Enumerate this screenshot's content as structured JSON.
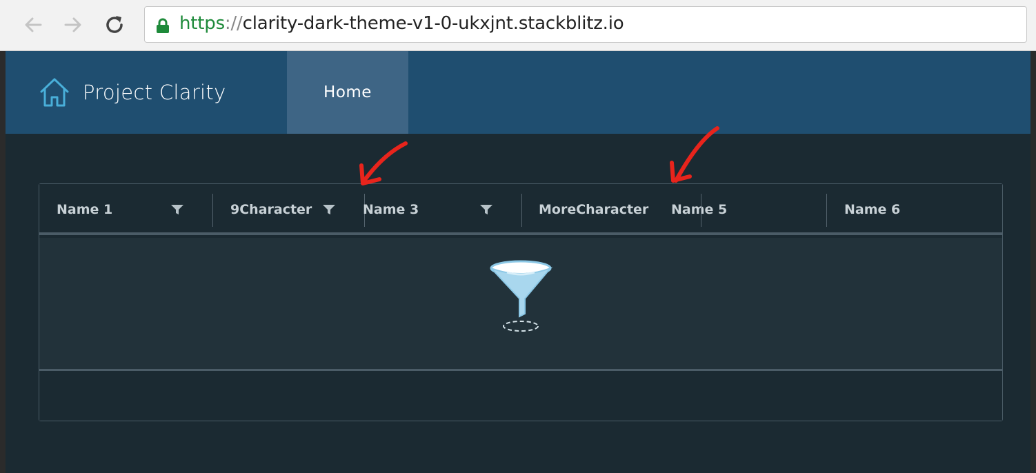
{
  "browser": {
    "url_scheme": "https",
    "url_separator": "://",
    "url_host": "clarity-dark-theme-v1-0-ukxjnt.stackblitz.io",
    "icons": [
      "back-arrow-icon",
      "forward-arrow-icon",
      "reload-icon",
      "lock-icon"
    ]
  },
  "header": {
    "brand_title": "Project Clarity",
    "brand_icon": "home-icon",
    "nav": [
      {
        "label": "Home",
        "active": true
      }
    ]
  },
  "datagrid": {
    "columns": [
      {
        "label": "Name 1",
        "filter": true
      },
      {
        "label": "9Character",
        "filter": true
      },
      {
        "label": "Name 3",
        "filter": true
      },
      {
        "label": "MoreCharacter",
        "filter": false
      },
      {
        "label": "Name 5",
        "filter": false
      },
      {
        "label": "Name 6",
        "filter": false
      }
    ],
    "empty_state_icon": "funnel-icon"
  },
  "annotations": {
    "arrow_color": "#e8241c",
    "count": 2
  },
  "colors": {
    "header_bg": "#1f4e70",
    "active_nav_bg": "#3e6585",
    "body_bg": "#1b2a32",
    "grid_border": "#4b5c67"
  }
}
